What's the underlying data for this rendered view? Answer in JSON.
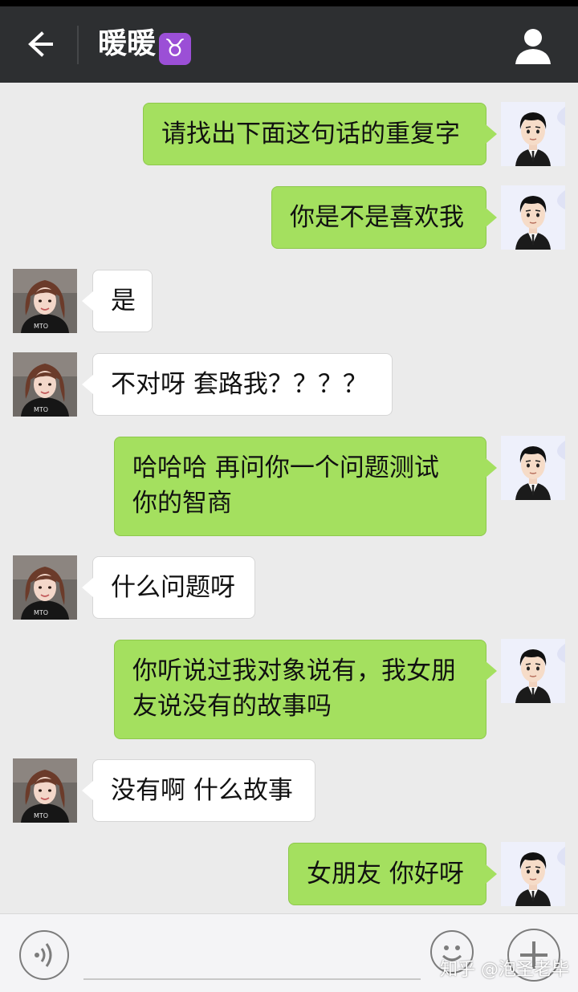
{
  "header": {
    "title": "暖暖",
    "title_sign": "♉",
    "background": "#2d2f31"
  },
  "messages": [
    {
      "side": "right",
      "text": "请找出下面这句话的重复字"
    },
    {
      "side": "right",
      "text": "你是不是喜欢我"
    },
    {
      "side": "left",
      "text": "是"
    },
    {
      "side": "left",
      "text": "不对呀 套路我？？？？"
    },
    {
      "side": "right",
      "line1": "哈哈哈 再问你一个问题测试",
      "line2": "你的智商"
    },
    {
      "side": "left",
      "text": "什么问题呀"
    },
    {
      "side": "right",
      "line1": "你听说过我对象说有，我女朋",
      "line2": "友说没有的故事吗"
    },
    {
      "side": "left",
      "text": "没有啊 什么故事"
    },
    {
      "side": "right",
      "text": "女朋友 你好呀"
    }
  ],
  "colors": {
    "outgoing_bubble": "#a4e05f",
    "incoming_bubble": "#ffffff",
    "chat_background": "#ebebeb"
  },
  "icons": {
    "back": "arrow-left-icon",
    "profile": "person-icon",
    "voice": "voice-icon",
    "emoji": "emoji-icon",
    "plus": "plus-icon"
  },
  "input": {
    "value": "",
    "placeholder": ""
  },
  "watermark": "知乎 @泡圣老毕"
}
